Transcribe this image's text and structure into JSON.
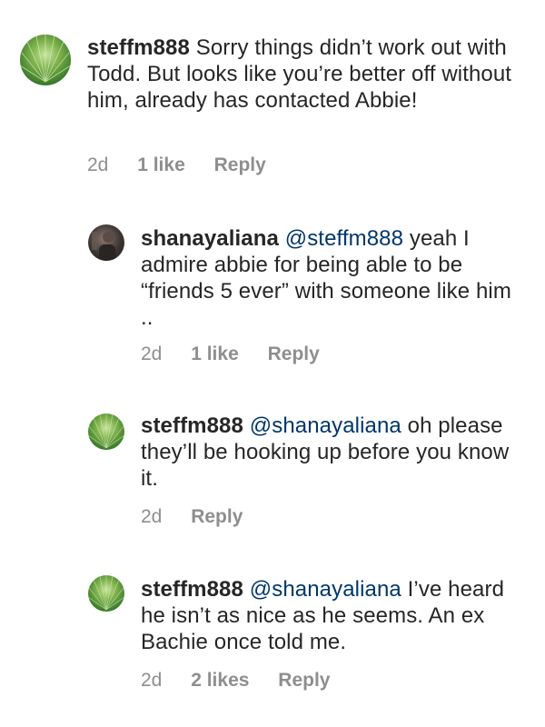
{
  "comments": [
    {
      "username": "steffm888",
      "mention": "",
      "text": "Sorry things didn’t work out with Todd. But looks like you’re better off without him, already has contacted Abbie!",
      "time": "2d",
      "likes": "1 like",
      "reply": "Reply",
      "avatar_icon": "palm-leaf-avatar"
    },
    {
      "username": "shanayaliana",
      "mention": "@steffm888",
      "text": "yeah I admire abbie for being able to be “friends 5 ever” with someone like him ..",
      "time": "2d",
      "likes": "1 like",
      "reply": "Reply",
      "avatar_icon": "photo-avatar"
    },
    {
      "username": "steffm888",
      "mention": "@shanayaliana",
      "text": "oh please they’ll be hooking up before you know it.",
      "time": "2d",
      "likes": "",
      "reply": "Reply",
      "avatar_icon": "palm-leaf-avatar"
    },
    {
      "username": "steffm888",
      "mention": "@shanayaliana",
      "text": "I’ve heard he isn’t as nice as he seems. An ex Bachie once told me.",
      "time": "2d",
      "likes": "2 likes",
      "reply": "Reply",
      "avatar_icon": "palm-leaf-avatar"
    }
  ],
  "colors": {
    "username": "#262626",
    "mention": "#00376b",
    "meta": "#8e8e8e"
  }
}
